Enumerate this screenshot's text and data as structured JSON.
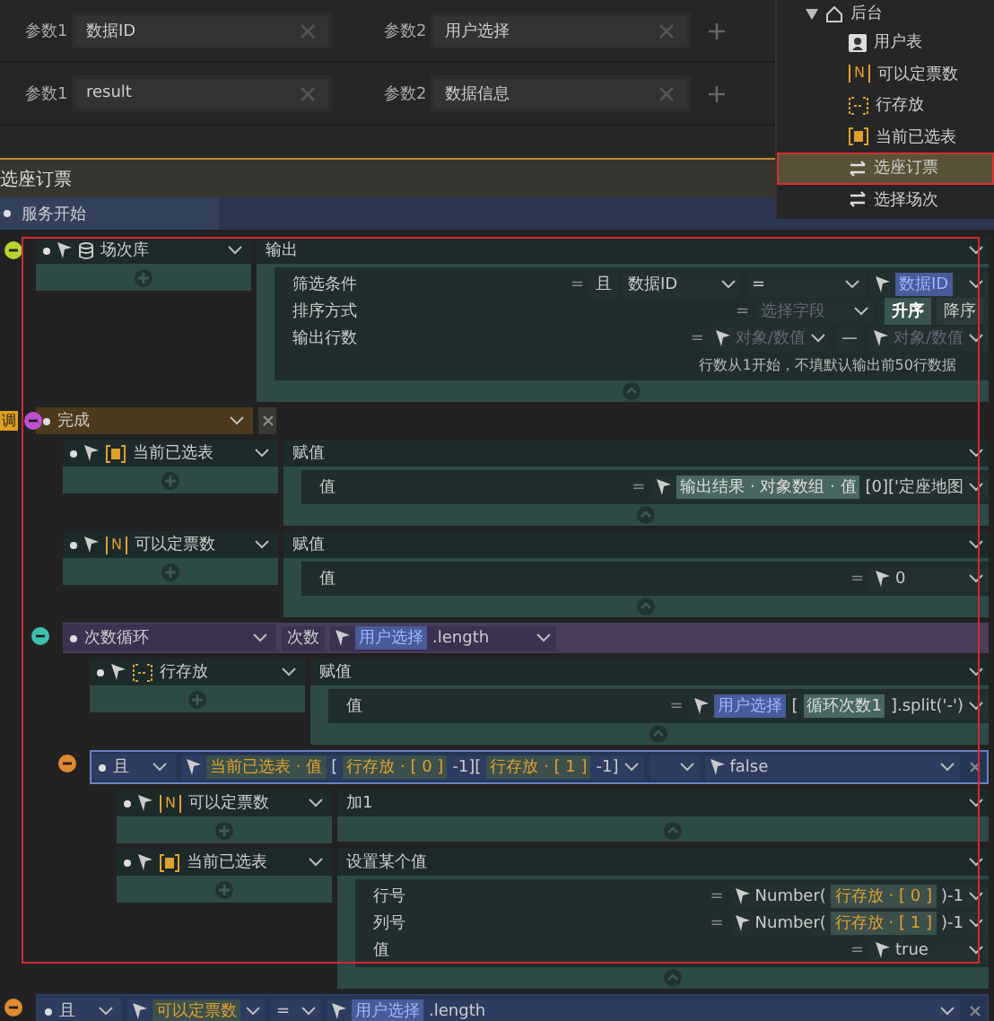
{
  "params": [
    [
      {
        "label": "参数1",
        "value": "数据ID"
      },
      {
        "label": "参数2",
        "value": "用户选择"
      }
    ],
    [
      {
        "label": "参数1",
        "value": "result"
      },
      {
        "label": "参数2",
        "value": "数据信息"
      }
    ]
  ],
  "tree": {
    "label": "后台",
    "expanded": true,
    "children": [
      {
        "label": "用户表",
        "kind": "user",
        "selected": false
      },
      {
        "label": "可以定票数",
        "kind": "number",
        "icon_text": "N",
        "selected": false
      },
      {
        "label": "行存放",
        "kind": "array",
        "selected": false
      },
      {
        "label": "当前已选表",
        "kind": "grid",
        "selected": false
      },
      {
        "label": "选座订票",
        "kind": "swap",
        "selected": true
      },
      {
        "label": "选择场次",
        "kind": "swap",
        "selected": false
      }
    ]
  },
  "section_title": "选座订票",
  "start": "服务开始",
  "blocks": [
    {
      "kind": "action",
      "target": {
        "kind": "database",
        "label": "场次库"
      },
      "panel": {
        "title": "输出",
        "fields": [
          {
            "label": "筛选条件",
            "eq": "=",
            "boxes": [
              {
                "tokens": [
                  {
                    "kind": "text",
                    "text": "且"
                  }
                ]
              },
              {
                "caret": true,
                "tokens": [
                  {
                    "kind": "text",
                    "text": "数据ID"
                  }
                ]
              },
              {
                "caret": true,
                "tokens": [
                  {
                    "kind": "text",
                    "text": "="
                  }
                ]
              },
              {
                "caret": true,
                "tokens": [
                  {
                    "kind": "pointer"
                  },
                  {
                    "kind": "ref",
                    "text": "数据ID"
                  }
                ]
              }
            ]
          },
          {
            "label": "排序方式",
            "eq": "=",
            "boxes": [
              {
                "caret": true,
                "tokens": [
                  {
                    "kind": "placeholder",
                    "text": "选择字段"
                  }
                ]
              },
              {
                "tokens": [
                  {
                    "kind": "toggle",
                    "text": "升序",
                    "selected": true
                  },
                  {
                    "kind": "toggle",
                    "text": "降序",
                    "selected": false
                  }
                ]
              }
            ]
          },
          {
            "label": "输出行数",
            "eq": "=",
            "boxes": [
              {
                "caret": true,
                "tokens": [
                  {
                    "kind": "pointer"
                  },
                  {
                    "kind": "placeholder",
                    "text": "对象/数值"
                  }
                ]
              },
              {
                "tokens": [
                  {
                    "kind": "text",
                    "text": "—"
                  }
                ]
              },
              {
                "caret": true,
                "tokens": [
                  {
                    "kind": "pointer"
                  },
                  {
                    "kind": "placeholder",
                    "text": "对象/数值"
                  }
                ]
              }
            ]
          }
        ],
        "note": "行数从1开始，不填默认输出前50行数据"
      }
    },
    {
      "kind": "event",
      "label": "完成",
      "badge": "调",
      "children": [
        {
          "kind": "action",
          "target": {
            "kind": "grid",
            "label": "当前已选表"
          },
          "panel": {
            "title": "赋值",
            "fields": [
              {
                "label": "值",
                "eq": "=",
                "boxes": [
                  {
                    "caret": true,
                    "tokens": [
                      {
                        "kind": "pointer"
                      },
                      {
                        "kind": "chip",
                        "text": "输出结果 · 对象数组 · 值"
                      },
                      {
                        "kind": "text",
                        "text": "[0]['定座地图"
                      }
                    ]
                  }
                ]
              }
            ]
          }
        },
        {
          "kind": "action",
          "target": {
            "kind": "number",
            "icon_text": "N",
            "label": "可以定票数"
          },
          "panel": {
            "title": "赋值",
            "fields": [
              {
                "label": "值",
                "eq": "=",
                "boxes": [
                  {
                    "caret": true,
                    "tokens": [
                      {
                        "kind": "pointer"
                      },
                      {
                        "kind": "text",
                        "text": "0"
                      }
                    ]
                  }
                ]
              }
            ]
          }
        },
        {
          "kind": "loop",
          "label": "次数循环",
          "header": [
            {
              "tokens": [
                {
                  "kind": "label",
                  "text": "次数"
                }
              ]
            },
            {
              "caret": true,
              "tokens": [
                {
                  "kind": "pointer"
                },
                {
                  "kind": "ref",
                  "text": "用户选择"
                },
                {
                  "kind": "text",
                  "text": ".length"
                }
              ]
            }
          ],
          "children": [
            {
              "kind": "action",
              "target": {
                "kind": "array",
                "label": "行存放"
              },
              "panel": {
                "title": "赋值",
                "fields": [
                  {
                    "label": "值",
                    "eq": "=",
                    "boxes": [
                      {
                        "caret": true,
                        "tokens": [
                          {
                            "kind": "pointer"
                          },
                          {
                            "kind": "ref",
                            "text": "用户选择"
                          },
                          {
                            "kind": "text",
                            "text": "["
                          },
                          {
                            "kind": "chip",
                            "text": "循环次数1"
                          },
                          {
                            "kind": "text",
                            "text": "].split('-')"
                          }
                        ]
                      }
                    ]
                  }
                ]
              }
            },
            {
              "kind": "condition",
              "label": "且",
              "selected": true,
              "header": [
                {
                  "caret": true,
                  "tokens": [
                    {
                      "kind": "pointer"
                    },
                    {
                      "kind": "var",
                      "text": "当前已选表 · 值"
                    },
                    {
                      "kind": "text",
                      "text": "["
                    },
                    {
                      "kind": "var",
                      "text": "行存放 · [ 0 ]"
                    },
                    {
                      "kind": "text",
                      "text": "-1]["
                    },
                    {
                      "kind": "var",
                      "text": "行存放 · [ 1 ]"
                    },
                    {
                      "kind": "text",
                      "text": "-1]"
                    }
                  ]
                },
                {
                  "caret": true
                },
                {
                  "caret": true,
                  "tokens": [
                    {
                      "kind": "pointer"
                    },
                    {
                      "kind": "text",
                      "text": "false"
                    }
                  ]
                }
              ],
              "children": [
                {
                  "kind": "action",
                  "target": {
                    "kind": "number",
                    "icon_text": "N",
                    "label": "可以定票数"
                  },
                  "panel": {
                    "title": "加1"
                  }
                },
                {
                  "kind": "action",
                  "target": {
                    "kind": "grid",
                    "label": "当前已选表"
                  },
                  "panel": {
                    "title": "设置某个值",
                    "fields": [
                      {
                        "label": "行号",
                        "eq": "=",
                        "boxes": [
                          {
                            "caret": true,
                            "tokens": [
                              {
                                "kind": "pointer"
                              },
                              {
                                "kind": "text",
                                "text": "Number("
                              },
                              {
                                "kind": "var",
                                "text": "行存放 · [ 0 ]"
                              },
                              {
                                "kind": "text",
                                "text": ")-1"
                              }
                            ]
                          }
                        ]
                      },
                      {
                        "label": "列号",
                        "eq": "=",
                        "boxes": [
                          {
                            "caret": true,
                            "tokens": [
                              {
                                "kind": "pointer"
                              },
                              {
                                "kind": "text",
                                "text": "Number("
                              },
                              {
                                "kind": "var",
                                "text": "行存放 · [ 1 ]"
                              },
                              {
                                "kind": "text",
                                "text": ")-1"
                              }
                            ]
                          }
                        ]
                      },
                      {
                        "label": "值",
                        "eq": "=",
                        "boxes": [
                          {
                            "caret": true,
                            "tokens": [
                              {
                                "kind": "pointer"
                              },
                              {
                                "kind": "text",
                                "text": "true"
                              }
                            ]
                          }
                        ]
                      }
                    ]
                  }
                }
              ]
            }
          ]
        }
      ]
    },
    {
      "kind": "condition",
      "label": "且",
      "selected": false,
      "header": [
        {
          "caret": true,
          "tokens": [
            {
              "kind": "pointer"
            },
            {
              "kind": "var",
              "text": "可以定票数"
            }
          ]
        },
        {
          "caret": true,
          "tokens": [
            {
              "kind": "text",
              "text": "="
            }
          ]
        },
        {
          "caret": true,
          "tokens": [
            {
              "kind": "pointer"
            },
            {
              "kind": "ref",
              "text": "用户选择"
            },
            {
              "kind": "text",
              "text": ".length"
            }
          ]
        }
      ]
    }
  ]
}
